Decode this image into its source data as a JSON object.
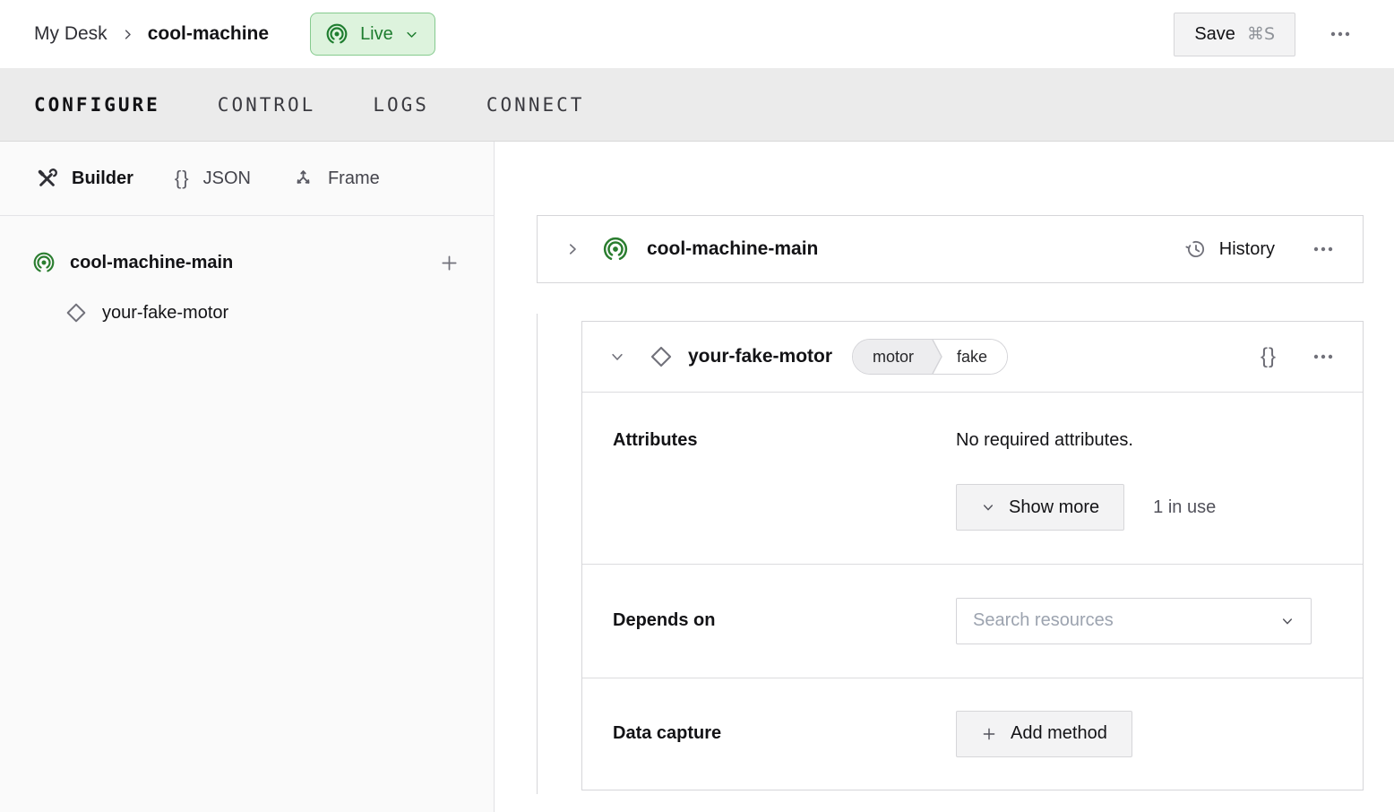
{
  "header": {
    "breadcrumb": {
      "parent": "My Desk",
      "current": "cool-machine"
    },
    "live_status": {
      "label": "Live"
    },
    "save_button": {
      "label": "Save",
      "shortcut": "⌘S"
    }
  },
  "nav_tabs": {
    "configure": "CONFIGURE",
    "control": "CONTROL",
    "logs": "LOGS",
    "connect": "CONNECT"
  },
  "sidebar": {
    "view_tabs": {
      "builder": "Builder",
      "json": "JSON",
      "frame": "Frame"
    },
    "tree": {
      "part": "cool-machine-main",
      "component": "your-fake-motor"
    }
  },
  "main": {
    "part_card": {
      "title": "cool-machine-main",
      "history_label": "History"
    },
    "component_card": {
      "title": "your-fake-motor",
      "type_badge": "motor",
      "model_badge": "fake",
      "attributes": {
        "label": "Attributes",
        "empty_text": "No required attributes.",
        "show_more_label": "Show more",
        "in_use_text": "1 in use"
      },
      "depends_on": {
        "label": "Depends on",
        "search_placeholder": "Search resources"
      },
      "data_capture": {
        "label": "Data capture",
        "add_method_label": "Add method"
      }
    }
  },
  "icons": {
    "braces": "{}"
  },
  "colors": {
    "accent_green": "#1e7d2f",
    "live_badge_bg": "#ddf3dd",
    "live_badge_border": "#85ca8e",
    "tab_bar_bg": "#ebebeb",
    "card_border": "#d6d6d9",
    "button_bg": "#f3f3f4"
  }
}
